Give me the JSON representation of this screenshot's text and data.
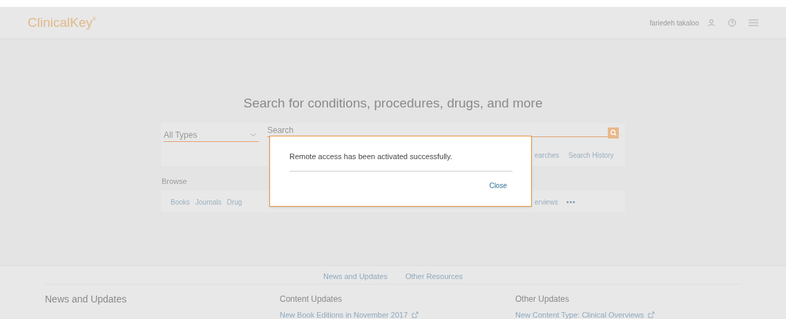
{
  "header": {
    "logo": "ClinicalKey",
    "logo_mark": "®",
    "user": "fariedeh takaloo"
  },
  "search": {
    "heading": "Search for conditions, procedures, drugs, and more",
    "type_select": "All Types",
    "placeholder": "Search",
    "links": [
      "earches",
      "Search History"
    ]
  },
  "browse": {
    "label": "Browse",
    "items": [
      "Books",
      "Journals",
      "Drug"
    ],
    "items_right": [
      "erviews"
    ],
    "more": "•••"
  },
  "dialog": {
    "message": "Remote access has been activated successfully.",
    "button": "Close"
  },
  "footer": {
    "tabs": [
      "News and Updates",
      "Other Resources"
    ],
    "title": "News and Updates",
    "columns": [
      {
        "heading": "Content Updates",
        "link": "New Book Editions in November 2017"
      },
      {
        "heading": "Other Updates",
        "link": "New Content Type: Clinical Overviews"
      }
    ]
  }
}
